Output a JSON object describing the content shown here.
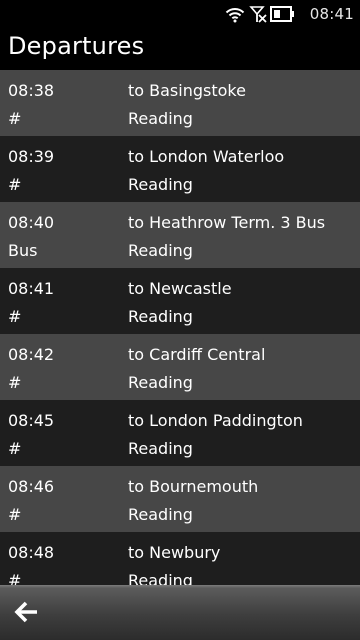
{
  "status_bar": {
    "time": "08:41",
    "icons": [
      "wifi-icon",
      "no-sim-signal-icon",
      "battery-icon"
    ]
  },
  "header": {
    "title": "Departures"
  },
  "departures": [
    {
      "time": "08:38",
      "destination": "to Basingstoke",
      "platform": "#",
      "via": "Reading"
    },
    {
      "time": "08:39",
      "destination": "to London Waterloo",
      "platform": "#",
      "via": "Reading"
    },
    {
      "time": "08:40",
      "destination": "to Heathrow Term. 3 Bus",
      "platform": "Bus",
      "via": "Reading"
    },
    {
      "time": "08:41",
      "destination": "to Newcastle",
      "platform": "#",
      "via": "Reading"
    },
    {
      "time": "08:42",
      "destination": "to Cardiff Central",
      "platform": "#",
      "via": "Reading"
    },
    {
      "time": "08:45",
      "destination": "to London Paddington",
      "platform": "#",
      "via": "Reading"
    },
    {
      "time": "08:46",
      "destination": "to Bournemouth",
      "platform": "#",
      "via": "Reading"
    },
    {
      "time": "08:48",
      "destination": "to Newbury",
      "platform": "#",
      "via": "Reading"
    }
  ],
  "toolbar": {
    "back_icon": "back-arrow-icon"
  },
  "colors": {
    "row_light": "#474747",
    "row_dark": "#1e1e1e",
    "title_background": "#000000",
    "text": "#ffffff"
  }
}
